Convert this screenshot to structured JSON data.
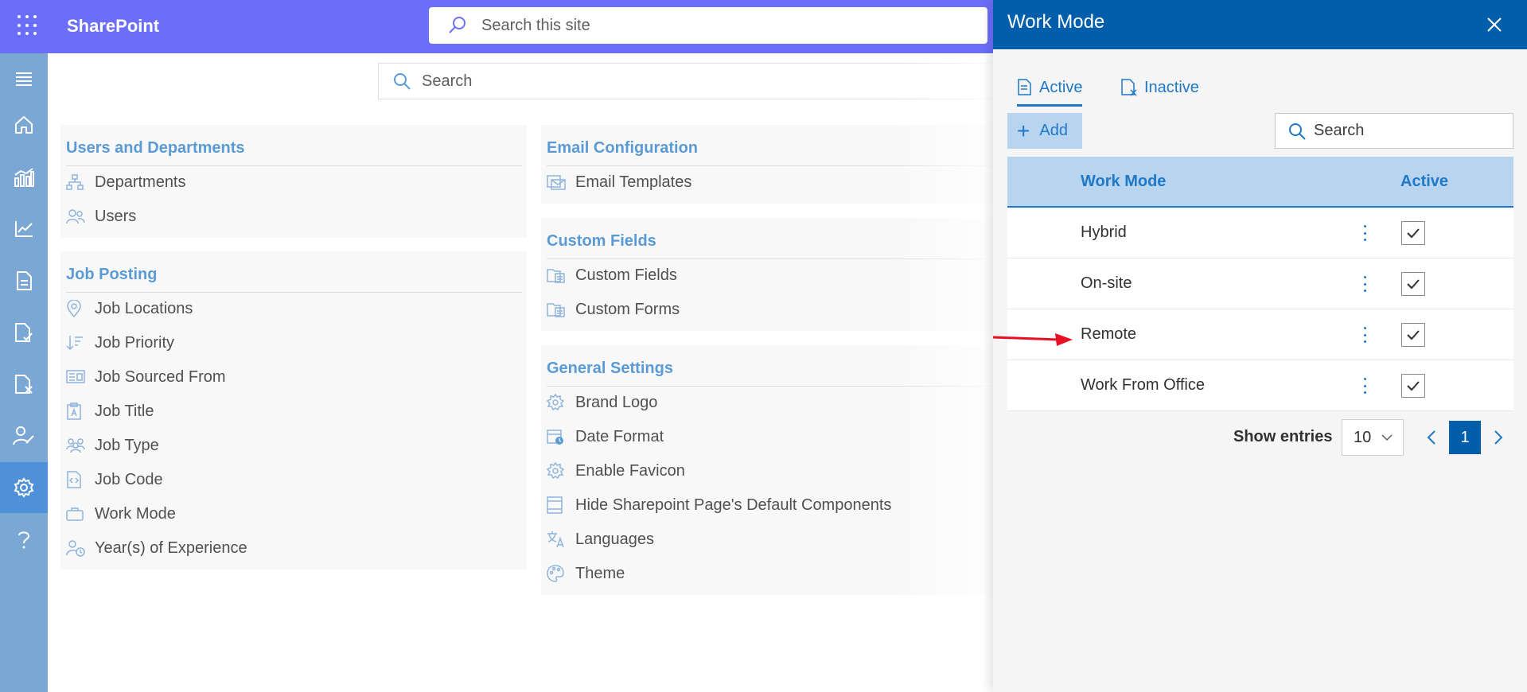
{
  "app": {
    "name": "SharePoint"
  },
  "header": {
    "search_placeholder": "Search this site"
  },
  "rail": {
    "items": [
      "menu-icon",
      "home-icon",
      "analytics-icon",
      "line-chart-icon",
      "document-icon",
      "document-check-icon",
      "document-cancel-icon",
      "person-edit-icon",
      "settings-icon",
      "help-icon"
    ],
    "active": "settings-icon"
  },
  "main": {
    "search_placeholder": "Search",
    "sections": [
      {
        "title": "Users and Departments",
        "items": [
          "Departments",
          "Users"
        ]
      },
      {
        "title": "Job Posting",
        "items": [
          "Job Locations",
          "Job Priority",
          "Job Sourced From",
          "Job Title",
          "Job Type",
          "Job Code",
          "Work Mode",
          "Year(s) of Experience"
        ]
      },
      {
        "title": "Email Configuration",
        "items": [
          "Email Templates"
        ]
      },
      {
        "title": "Custom Fields",
        "items": [
          "Custom Fields",
          "Custom Forms"
        ]
      },
      {
        "title": "General Settings",
        "items": [
          "Brand Logo",
          "Date Format",
          "Enable Favicon",
          "Hide Sharepoint Page's Default Components",
          "Languages",
          "Theme"
        ]
      }
    ]
  },
  "panel": {
    "title": "Work Mode",
    "tabs": [
      {
        "label": "Active",
        "active": true
      },
      {
        "label": "Inactive",
        "active": false
      }
    ],
    "add_label": "Add",
    "search_placeholder": "Search",
    "table": {
      "headers": [
        "Work Mode",
        "Active"
      ],
      "rows": [
        {
          "name": "Hybrid",
          "active": true
        },
        {
          "name": "On-site",
          "active": true
        },
        {
          "name": "Remote",
          "active": true
        },
        {
          "name": "Work From Office",
          "active": true
        }
      ]
    },
    "pager": {
      "label": "Show entries",
      "page_size": "10",
      "current_page": "1"
    }
  },
  "colors": {
    "topbar": "#6b6ef8",
    "rail": "#7ba7d4",
    "rail_active": "#4f91d9",
    "panel_header": "#005eaa",
    "accent": "#1f78c8",
    "section_title": "#5b9bd5",
    "annotation_arrow": "#e81123"
  }
}
